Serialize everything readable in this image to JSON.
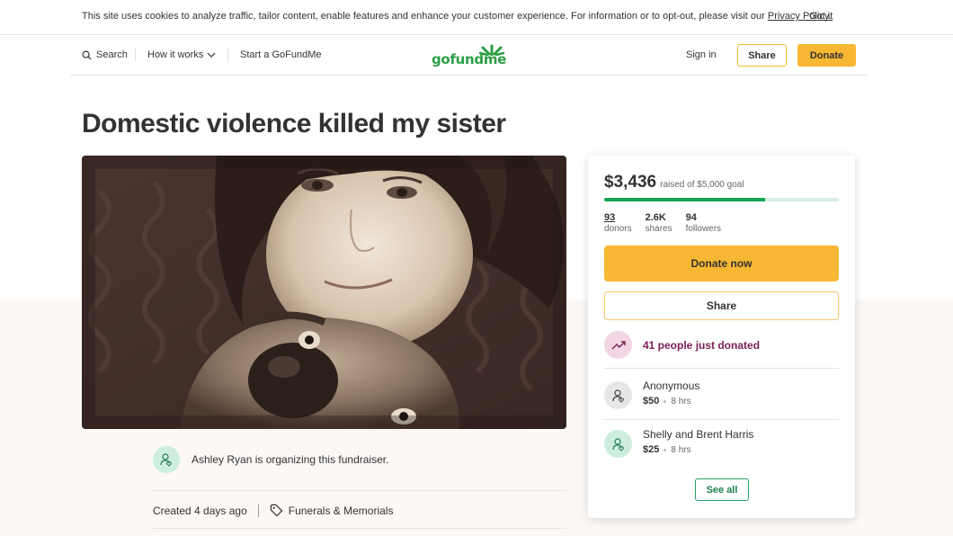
{
  "cookie_banner": {
    "text": "This site uses cookies to analyze traffic, tailor content, enable features and enhance your customer experience. For information or to opt-out, please visit our ",
    "privacy_link": "Privacy Policy.",
    "got_it": "Got it"
  },
  "nav": {
    "search": "Search",
    "how_it_works": "How it works",
    "start": "Start a GoFundMe",
    "logo": "gofundme",
    "sign_in": "Sign in",
    "share": "Share",
    "donate": "Donate"
  },
  "campaign": {
    "title": "Domestic violence killed my sister",
    "organizer": "Ashley Ryan is organizing this fundraiser.",
    "created": "Created 4 days ago",
    "category": "Funerals & Memorials"
  },
  "donation_card": {
    "amount": "$3,436",
    "goal_text": "raised of $5,000 goal",
    "progress_fraction": 0.687,
    "stats": [
      {
        "value": "93",
        "label": "donors"
      },
      {
        "value": "2.6K",
        "label": "shares"
      },
      {
        "value": "94",
        "label": "followers"
      }
    ],
    "donate_now": "Donate now",
    "share": "Share",
    "trend_text": "41 people just donated",
    "donors": [
      {
        "name": "Anonymous",
        "amount": "$50",
        "time": "8 hrs"
      },
      {
        "name": "Shelly and Brent Harris",
        "amount": "$25",
        "time": "8 hrs"
      }
    ],
    "see_all": "See all"
  },
  "colors": {
    "brand_green": "#2b9e45",
    "donate_yellow": "#f7b733",
    "trend_purple": "#7a1f55"
  }
}
